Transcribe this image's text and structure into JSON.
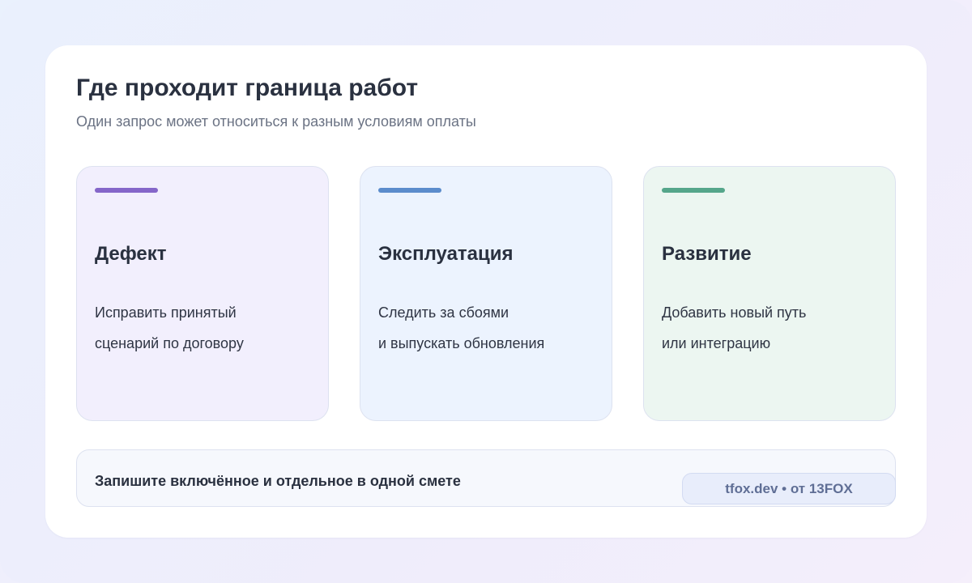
{
  "header": {
    "title": "Где проходит граница работ",
    "subtitle": "Один запрос может относиться к разным условиям оплаты"
  },
  "tiles": [
    {
      "heading": "Дефект",
      "lines": [
        "Исправить принятый",
        "сценарий по договору"
      ],
      "accent": "#8566c9",
      "background": "#f2effd"
    },
    {
      "heading": "Эксплуатация",
      "lines": [
        "Следить за сбоями",
        "и выпускать обновления"
      ],
      "accent": "#5b8ccc",
      "background": "#ecf3fe"
    },
    {
      "heading": "Развитие",
      "lines": [
        "Добавить новый путь",
        "или интеграцию"
      ],
      "accent": "#55a68b",
      "background": "#ecf6f1"
    }
  ],
  "footer": {
    "note": "Запишите включённое и отдельное в одной смете",
    "badge": "tfox.dev • от 13FOX"
  }
}
